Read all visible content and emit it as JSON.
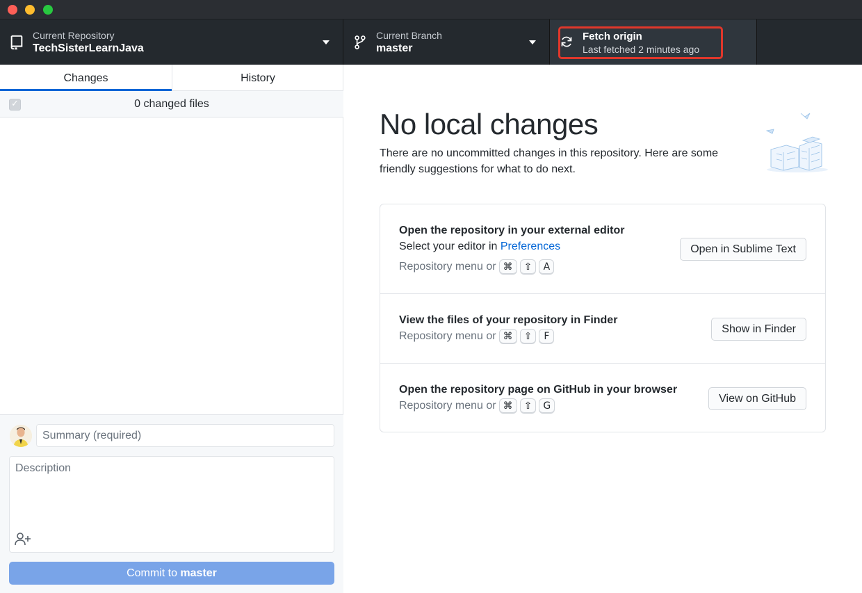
{
  "toolbar": {
    "repo": {
      "title": "Current Repository",
      "value": "TechSisterLearnJava"
    },
    "branch": {
      "title": "Current Branch",
      "value": "master"
    },
    "fetch": {
      "title": "Fetch origin",
      "subtitle": "Last fetched 2 minutes ago",
      "highlight_color": "#e0372b"
    }
  },
  "sidebar": {
    "tabs": [
      {
        "label": "Changes",
        "active": true
      },
      {
        "label": "History",
        "active": false
      }
    ],
    "files_count_label": "0 changed files",
    "summary_placeholder": "Summary (required)",
    "description_placeholder": "Description",
    "commit": {
      "prefix": "Commit to ",
      "branch": "master"
    }
  },
  "main": {
    "heading": "No local changes",
    "intro": "There are no uncommitted changes in this repository. Here are some friendly suggestions for what to do next.",
    "suggestions": [
      {
        "title": "Open the repository in your external editor",
        "subtitle_prefix": "Select your editor in ",
        "subtitle_link": "Preferences",
        "shortcut_prefix": "Repository menu or",
        "keys": [
          "⌘",
          "⇧",
          "A"
        ],
        "button": "Open in Sublime Text"
      },
      {
        "title": "View the files of your repository in Finder",
        "shortcut_prefix": "Repository menu or",
        "keys": [
          "⌘",
          "⇧",
          "F"
        ],
        "button": "Show in Finder"
      },
      {
        "title": "Open the repository page on GitHub in your browser",
        "shortcut_prefix": "Repository menu or",
        "keys": [
          "⌘",
          "⇧",
          "G"
        ],
        "button": "View on GitHub"
      }
    ]
  },
  "colors": {
    "accent": "#0366d6",
    "toolbar_bg": "#24292e",
    "commit_button": "#79a4e8"
  }
}
